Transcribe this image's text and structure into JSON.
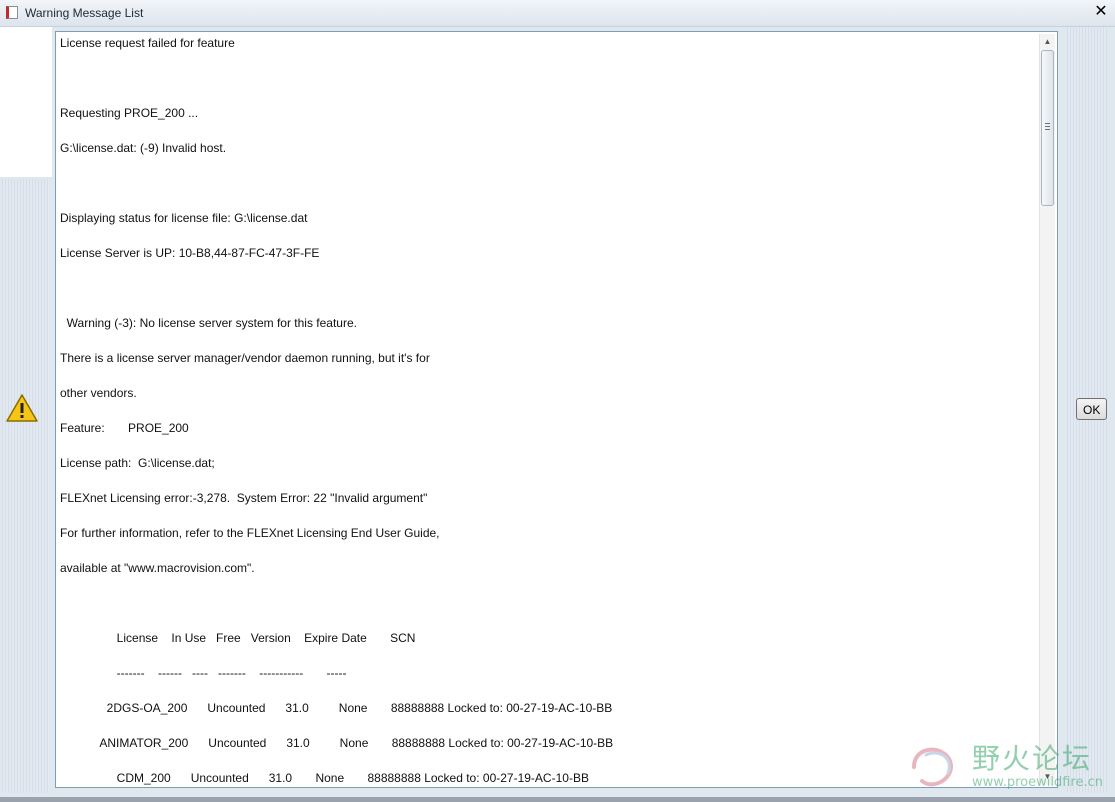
{
  "window": {
    "title": "Warning Message List",
    "close_glyph": "✕"
  },
  "icons": {
    "app": "app-window-icon",
    "warning": "warning-triangle-icon",
    "close": "close-icon",
    "scroll_up": "scroll-up-arrow-icon",
    "scroll_down": "scroll-down-arrow-icon"
  },
  "message": {
    "lines": [
      "License request failed for feature",
      "",
      "Requesting PROE_200 ...",
      "G:\\license.dat: (-9) Invalid host.",
      "",
      "Displaying status for license file: G:\\license.dat",
      "License Server is UP: 10-B8,44-87-FC-47-3F-FE",
      "",
      "  Warning (-3): No license server system for this feature.",
      "There is a license server manager/vendor daemon running, but it's for",
      "other vendors.",
      "Feature:       PROE_200",
      "License path:  G:\\license.dat;",
      "FLEXnet Licensing error:-3,278.  System Error: 22 \"Invalid argument\"",
      "For further information, refer to the FLEXnet Licensing End User Guide,",
      "available at \"www.macrovision.com\".",
      "",
      "                 License    In Use   Free   Version    Expire Date       SCN",
      "                 -------    ------   ----   -------    -----------       -----",
      "              2DGS-OA_200      Uncounted      31.0         None       88888888 Locked to: 00-27-19-AC-10-BB",
      "            ANIMATOR_200      Uncounted      31.0         None       88888888 Locked to: 00-27-19-AC-10-BB",
      "                 CDM_200      Uncounted      31.0       None       88888888 Locked to: 00-27-19-AC-10-BB"
    ]
  },
  "buttons": {
    "ok_label": "OK"
  },
  "watermark": {
    "text_cn": "野火论坛",
    "url": "www.proewildfire.cn"
  },
  "scrollbar": {
    "up_glyph": "▲",
    "down_glyph": "▼"
  }
}
